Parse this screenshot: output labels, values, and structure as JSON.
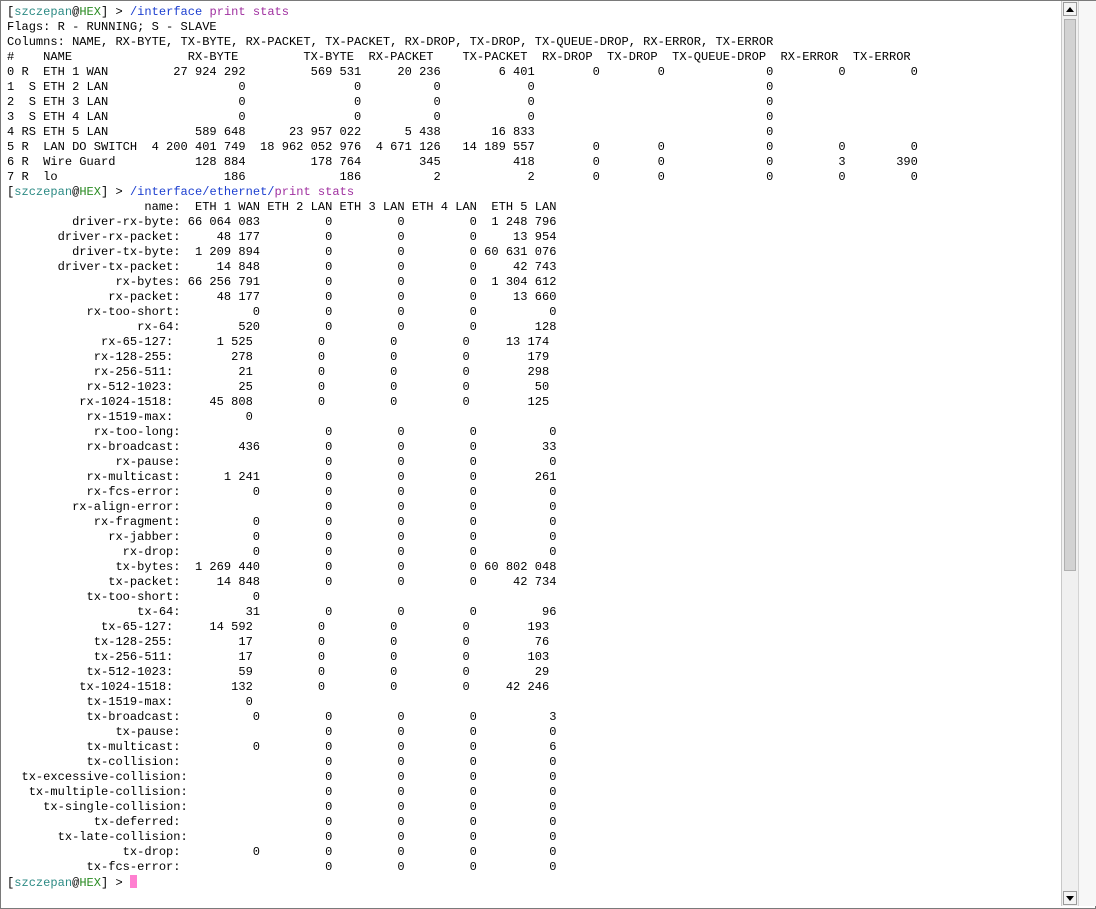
{
  "prompt": {
    "open": "[",
    "user": "szczepan",
    "at": "@",
    "host": "HEX",
    "close": "]",
    "arrow": " > "
  },
  "command1": {
    "path": "/interface",
    "args": " print stats"
  },
  "interface_print": [
    "Flags: R - RUNNING; S - SLAVE",
    "Columns: NAME, RX-BYTE, TX-BYTE, RX-PACKET, TX-PACKET, RX-DROP, TX-DROP, TX-QUEUE-DROP, RX-ERROR, TX-ERROR",
    "#    NAME                RX-BYTE         TX-BYTE  RX-PACKET    TX-PACKET  RX-DROP  TX-DROP  TX-QUEUE-DROP  RX-ERROR  TX-ERROR",
    "0 R  ETH 1 WAN         27 924 292         569 531     20 236        6 401        0        0              0         0         0",
    "1  S ETH 2 LAN                  0               0          0            0                                0",
    "2  S ETH 3 LAN                  0               0          0            0                                0",
    "3  S ETH 4 LAN                  0               0          0            0                                0",
    "4 RS ETH 5 LAN            589 648      23 957 022      5 438       16 833                                0",
    "5 R  LAN DO SWITCH  4 200 401 749  18 962 052 976  4 671 126   14 189 557        0        0              0         0         0",
    "6 R  Wire Guard           128 884         178 764        345          418        0        0              0         3       390",
    "7 R  lo                       186             186          2            2        0        0              0         0         0"
  ],
  "command2": {
    "path": "/interface/ethernet/",
    "args": "print stats"
  },
  "ethernet_stats": [
    "                   name:  ETH 1 WAN ETH 2 LAN ETH 3 LAN ETH 4 LAN  ETH 5 LAN",
    "         driver-rx-byte: 66 064 083         0         0         0  1 248 796",
    "       driver-rx-packet:     48 177         0         0         0     13 954",
    "         driver-tx-byte:  1 209 894         0         0         0 60 631 076",
    "       driver-tx-packet:     14 848         0         0         0     42 743",
    "               rx-bytes: 66 256 791         0         0         0  1 304 612",
    "              rx-packet:     48 177         0         0         0     13 660",
    "           rx-too-short:          0         0         0         0          0",
    "                  rx-64:        520         0         0         0        128",
    "             rx-65-127:      1 525         0         0         0     13 174",
    "            rx-128-255:        278         0         0         0        179",
    "            rx-256-511:         21         0         0         0        298",
    "           rx-512-1023:         25         0         0         0         50",
    "          rx-1024-1518:     45 808         0         0         0        125",
    "           rx-1519-max:          0",
    "            rx-too-long:                    0         0         0          0",
    "           rx-broadcast:        436         0         0         0         33",
    "               rx-pause:                    0         0         0          0",
    "           rx-multicast:      1 241         0         0         0        261",
    "           rx-fcs-error:          0         0         0         0          0",
    "         rx-align-error:                    0         0         0          0",
    "            rx-fragment:          0         0         0         0          0",
    "              rx-jabber:          0         0         0         0          0",
    "                rx-drop:          0         0         0         0          0",
    "               tx-bytes:  1 269 440         0         0         0 60 802 048",
    "              tx-packet:     14 848         0         0         0     42 734",
    "           tx-too-short:          0",
    "                  tx-64:         31         0         0         0         96",
    "             tx-65-127:     14 592         0         0         0        193",
    "            tx-128-255:         17         0         0         0         76",
    "            tx-256-511:         17         0         0         0        103",
    "           tx-512-1023:         59         0         0         0         29",
    "          tx-1024-1518:        132         0         0         0     42 246",
    "           tx-1519-max:          0",
    "           tx-broadcast:          0         0         0         0          3",
    "               tx-pause:                    0         0         0          0",
    "           tx-multicast:          0         0         0         0          6",
    "           tx-collision:                    0         0         0          0",
    "  tx-excessive-collision:                   0         0         0          0",
    "   tx-multiple-collision:                   0         0         0          0",
    "     tx-single-collision:                   0         0         0          0",
    "            tx-deferred:                    0         0         0          0",
    "       tx-late-collision:                   0         0         0          0",
    "                tx-drop:          0         0         0         0          0",
    "           tx-fcs-error:                    0         0         0          0"
  ],
  "colors": {
    "user": "#2c8a84",
    "host": "#2a8b22",
    "command": "#1c3fd0",
    "argument": "#a030a0",
    "cursor": "#ff7fd0"
  }
}
